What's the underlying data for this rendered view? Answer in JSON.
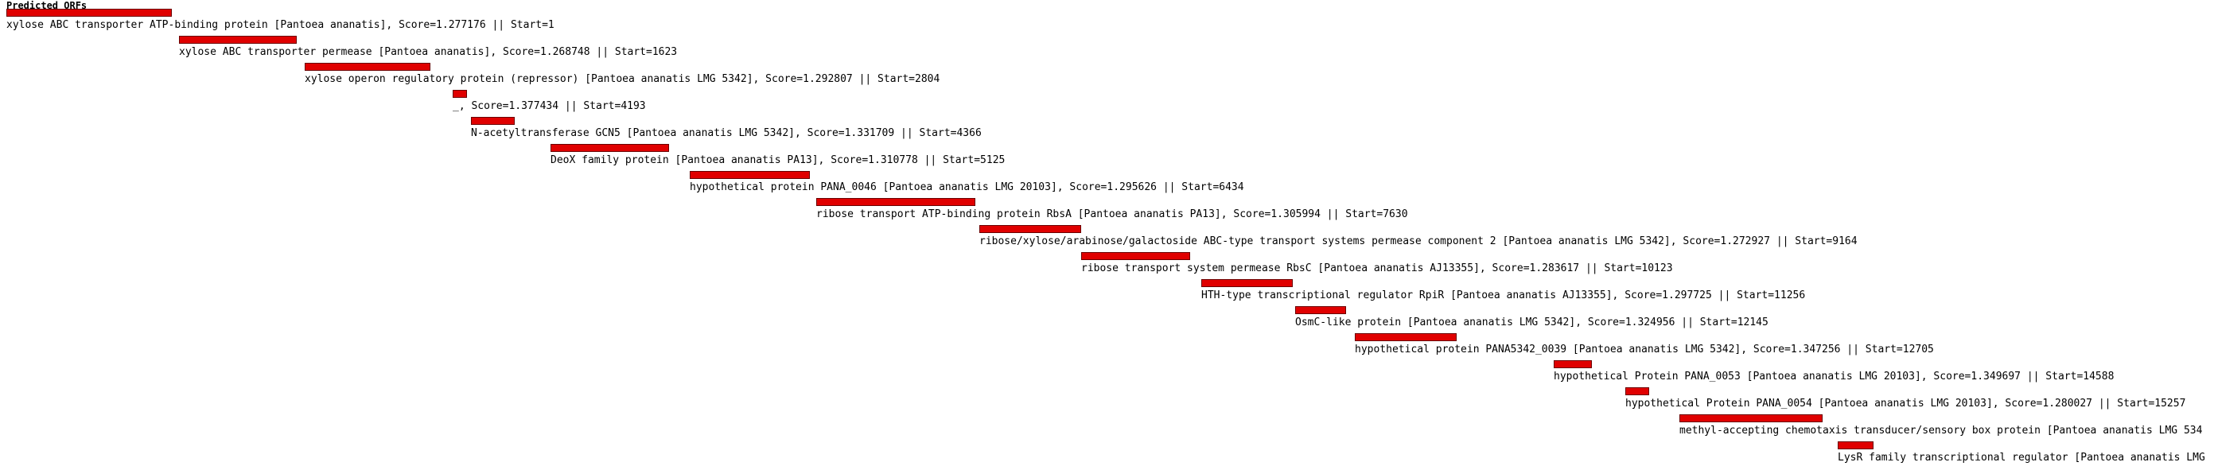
{
  "track": {
    "title": "Predicted ORFs",
    "bar_color": "#e00000",
    "bar_border": "#6a0000"
  },
  "orfs": [
    {
      "label": "xylose ABC transporter ATP-binding protein [Pantoea ananatis], Score=1.277176 || Start=1"
    },
    {
      "label": "xylose ABC transporter permease [Pantoea ananatis], Score=1.268748 || Start=1623"
    },
    {
      "label": "xylose operon regulatory protein (repressor) [Pantoea ananatis LMG 5342], Score=1.292807 || Start=2804"
    },
    {
      "label": "_, Score=1.377434 || Start=4193"
    },
    {
      "label": "N-acetyltransferase GCN5 [Pantoea ananatis LMG 5342], Score=1.331709 || Start=4366"
    },
    {
      "label": "DeoX family protein [Pantoea ananatis PA13], Score=1.310778 || Start=5125"
    },
    {
      "label": "hypothetical protein PANA_0046 [Pantoea ananatis LMG 20103], Score=1.295626 || Start=6434"
    },
    {
      "label": "ribose transport ATP-binding protein RbsA [Pantoea ananatis PA13], Score=1.305994 || Start=7630"
    },
    {
      "label": "ribose/xylose/arabinose/galactoside ABC-type transport systems permease component 2 [Pantoea ananatis LMG 5342], Score=1.272927 || Start=9164"
    },
    {
      "label": "ribose transport system permease RbsC [Pantoea ananatis AJ13355], Score=1.283617 || Start=10123"
    },
    {
      "label": "HTH-type transcriptional regulator RpiR [Pantoea ananatis AJ13355], Score=1.297725 || Start=11256"
    },
    {
      "label": "OsmC-like protein [Pantoea ananatis LMG 5342], Score=1.324956 || Start=12145"
    },
    {
      "label": "hypothetical protein PANA5342_0039 [Pantoea ananatis LMG 5342], Score=1.347256 || Start=12705"
    },
    {
      "label": "hypothetical Protein PANA_0053 [Pantoea ananatis LMG 20103], Score=1.349697 || Start=14588"
    },
    {
      "label": "hypothetical Protein PANA_0054 [Pantoea ananatis LMG 20103], Score=1.280027 || Start=15257"
    },
    {
      "label": "methyl-accepting chemotaxis transducer/sensory box protein [Pantoea ananatis LMG 534"
    },
    {
      "label": "LysR family transcriptional regulator [Pantoea ananatis LMG"
    }
  ]
}
